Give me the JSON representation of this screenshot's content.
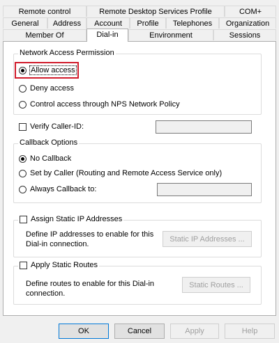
{
  "tabs": {
    "row1": [
      "Remote control",
      "Remote Desktop Services Profile",
      "COM+"
    ],
    "row2": [
      "General",
      "Address",
      "Account",
      "Profile",
      "Telephones",
      "Organization"
    ],
    "row3": [
      "Member Of",
      "Dial-in",
      "Environment",
      "Sessions"
    ],
    "active": "Dial-in"
  },
  "network_access": {
    "title": "Network Access Permission",
    "options": [
      "Allow access",
      "Deny access",
      "Control access through NPS Network Policy"
    ],
    "selected": "Allow access",
    "highlight_color": "#d11a2a"
  },
  "verify_caller_id": {
    "label": "Verify Caller-ID:",
    "value": ""
  },
  "callback": {
    "title": "Callback Options",
    "options": [
      "No Callback",
      "Set by Caller (Routing and Remote Access Service only)",
      "Always Callback to:"
    ],
    "selected": "No Callback",
    "always_value": ""
  },
  "static_ip": {
    "title": "Assign Static IP Addresses",
    "description_line1": "Define IP addresses to enable for this",
    "description_line2": "Dial-in connection.",
    "button": "Static IP Addresses ..."
  },
  "static_routes": {
    "title": "Apply Static Routes",
    "description_line1": "Define routes to enable for this Dial-in",
    "description_line2": "connection.",
    "button": "Static Routes ..."
  },
  "buttons": {
    "ok": "OK",
    "cancel": "Cancel",
    "apply": "Apply",
    "help": "Help"
  }
}
